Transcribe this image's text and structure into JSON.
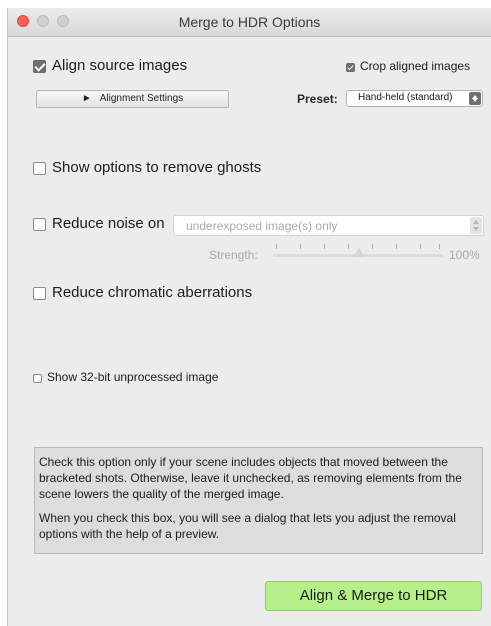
{
  "window": {
    "title": "Merge to HDR Options"
  },
  "align": {
    "label": "Align source images",
    "checked": true,
    "settings_button": "Alignment Settings",
    "crop_label": "Crop aligned images",
    "crop_checked": true,
    "preset_label": "Preset:",
    "preset_value": "Hand-held (standard)"
  },
  "ghosts": {
    "label": "Show options to remove ghosts",
    "checked": false
  },
  "noise": {
    "label": "Reduce noise on",
    "checked": false,
    "select_value": "underexposed image(s) only",
    "strength_label": "Strength:",
    "strength_value": "100%",
    "strength_fraction": 1.0
  },
  "chromatic": {
    "label": "Reduce chromatic aberrations",
    "checked": false
  },
  "unprocessed": {
    "label": "Show 32-bit unprocessed image",
    "checked": false
  },
  "info": {
    "paragraph1": "Check this option only if your scene includes objects that moved between the bracketed shots. Otherwise, leave it unchecked, as removing elements from the scene lowers the quality of the merged image.",
    "paragraph2": "When you check this box, you will see a dialog that lets you adjust the removal options with the help of a preview."
  },
  "actions": {
    "merge_button": "Align & Merge to HDR"
  },
  "colors": {
    "accent_green": "#b6f08a",
    "close_red": "#fc605b"
  },
  "icons": {
    "settings_chevron": "chevron-right-icon",
    "select_arrows": "updown-arrows-icon"
  }
}
